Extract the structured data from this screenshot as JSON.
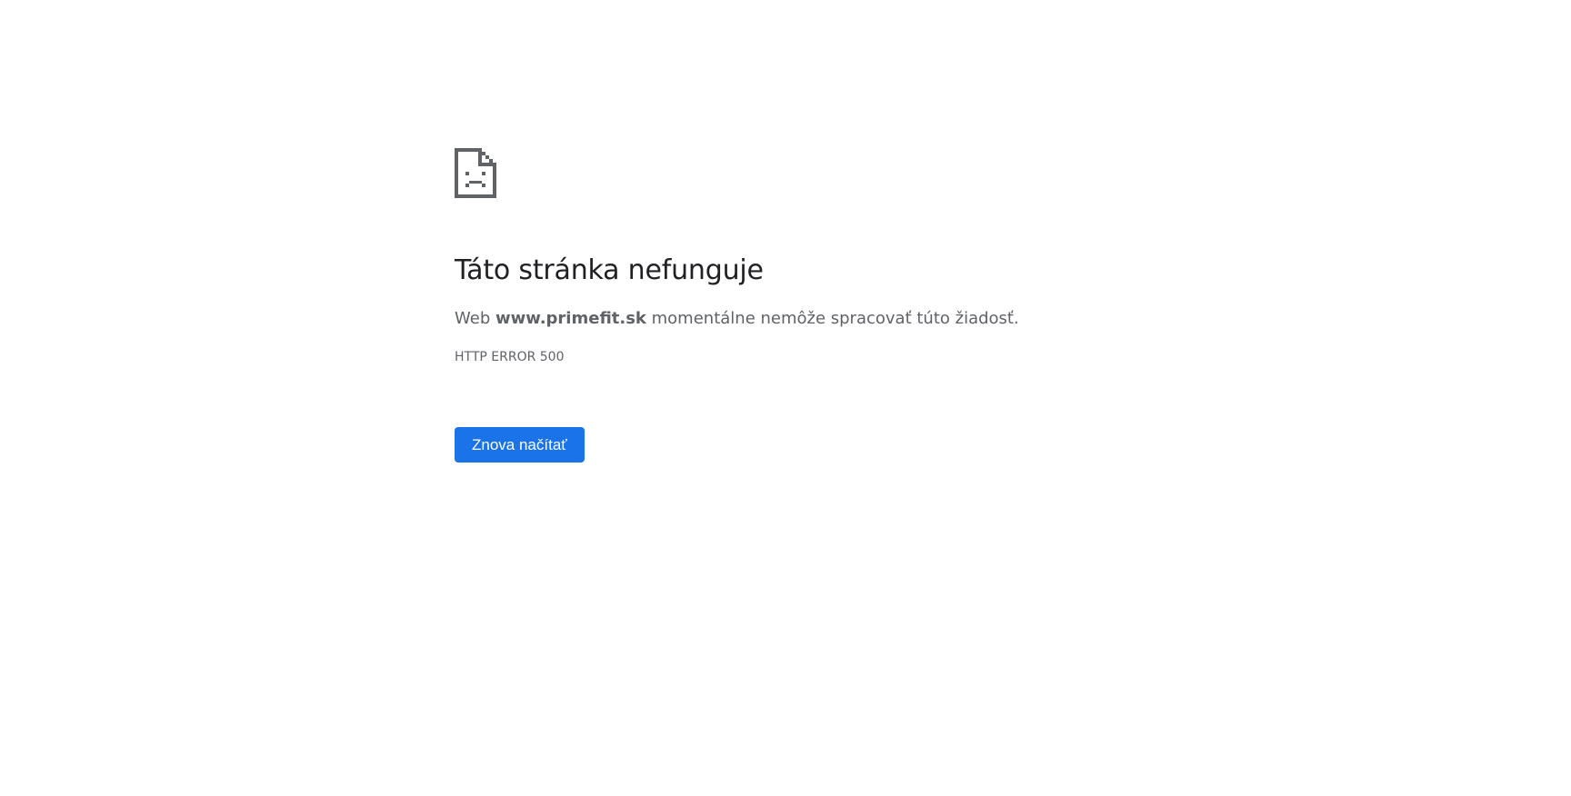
{
  "error_page": {
    "icon": "sad-page-icon",
    "title": "Táto stránka nefunguje",
    "message": {
      "prefix": "Web ",
      "host": "www.primefit.sk",
      "suffix": " momentálne nemôže spracovať túto žiadosť."
    },
    "error_code": "HTTP ERROR 500",
    "reload_label": "Znova načítať"
  },
  "colors": {
    "accent": "#1a73e8",
    "title": "#202124",
    "text": "#5f6368",
    "icon": "#5f6368"
  }
}
